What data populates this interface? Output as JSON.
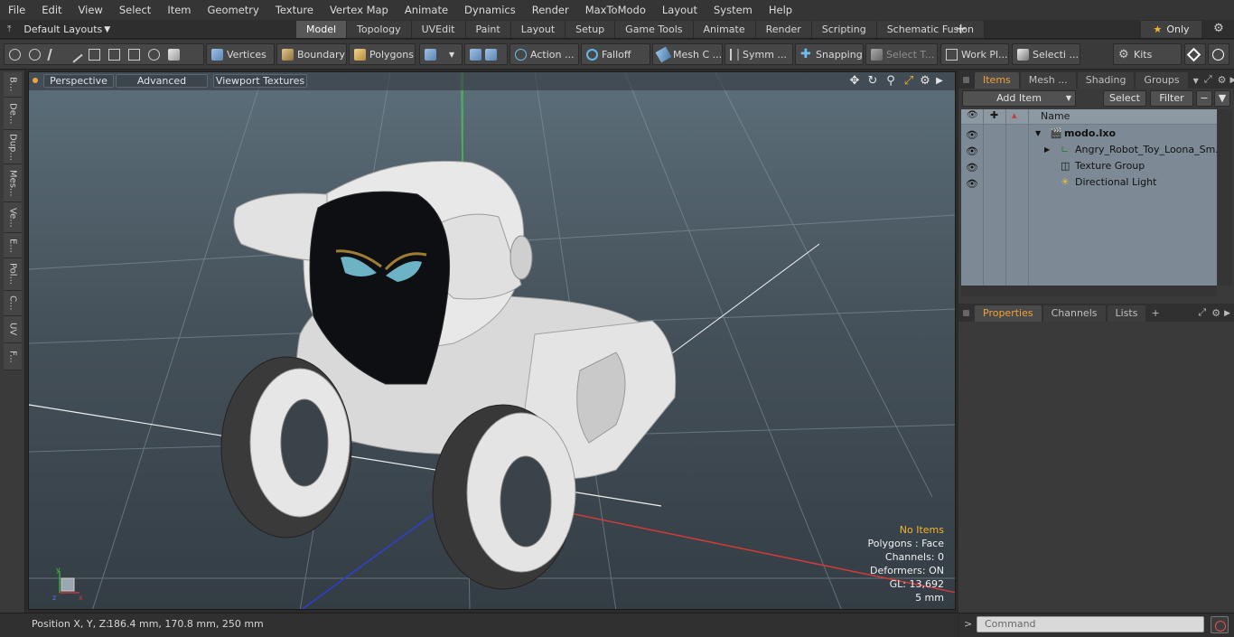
{
  "menu": [
    "File",
    "Edit",
    "View",
    "Select",
    "Item",
    "Geometry",
    "Texture",
    "Vertex Map",
    "Animate",
    "Dynamics",
    "Render",
    "MaxToModo",
    "Layout",
    "System",
    "Help"
  ],
  "layout_dropdown": "Default Layouts",
  "tabs": [
    "Model",
    "Topology",
    "UVEdit",
    "Paint",
    "Layout",
    "Setup",
    "Game Tools",
    "Animate",
    "Render",
    "Scripting",
    "Schematic Fusion"
  ],
  "active_tab": "Model",
  "only_label": "Only",
  "toolbar": {
    "vertices": "Vertices",
    "boundary": "Boundary",
    "polygons": "Polygons",
    "action": "Action ...",
    "falloff": "Falloff",
    "mesh_c": "Mesh C ...",
    "symm": "Symm ...",
    "snapping": "Snapping",
    "select_t": "Select T...",
    "work_pl": "Work Pl...",
    "selecti": "Selecti ...",
    "kits": "Kits"
  },
  "left_tabs": [
    "B...",
    "De...",
    "Dup...",
    "Mes...",
    "Ve...",
    "E...",
    "Pol...",
    "C...",
    "UV",
    "F..."
  ],
  "viewport": {
    "perspective": "Perspective",
    "advanced": "Advanced",
    "viewport_textures": "Viewport Textures",
    "info": {
      "no_items": "No Items",
      "polygons": "Polygons : Face",
      "channels": "Channels: 0",
      "deformers": "Deformers: ON",
      "gl": "GL: 13,692",
      "scale": "5 mm"
    }
  },
  "items_panel": {
    "tabs": [
      "Items",
      "Mesh ...",
      "Shading",
      "Groups"
    ],
    "add_item": "Add Item",
    "select": "Select",
    "filter": "Filter",
    "column_name": "Name",
    "tree": [
      {
        "label": "modo.lxo"
      },
      {
        "label": "Angry_Robot_Toy_Loona_Sm..."
      },
      {
        "label": "Texture Group"
      },
      {
        "label": "Directional Light"
      }
    ]
  },
  "properties_panel": {
    "tabs": [
      "Properties",
      "Channels",
      "Lists"
    ]
  },
  "status": {
    "position_label": "Position X, Y, Z:",
    "position_value": "186.4 mm, 170.8 mm, 250 mm"
  },
  "command": {
    "placeholder": "Command"
  },
  "colors": {
    "accent": "#f2a23b",
    "axis_x": "#d23a3a",
    "axis_y": "#3ec43e",
    "axis_z": "#2f3fd6"
  }
}
